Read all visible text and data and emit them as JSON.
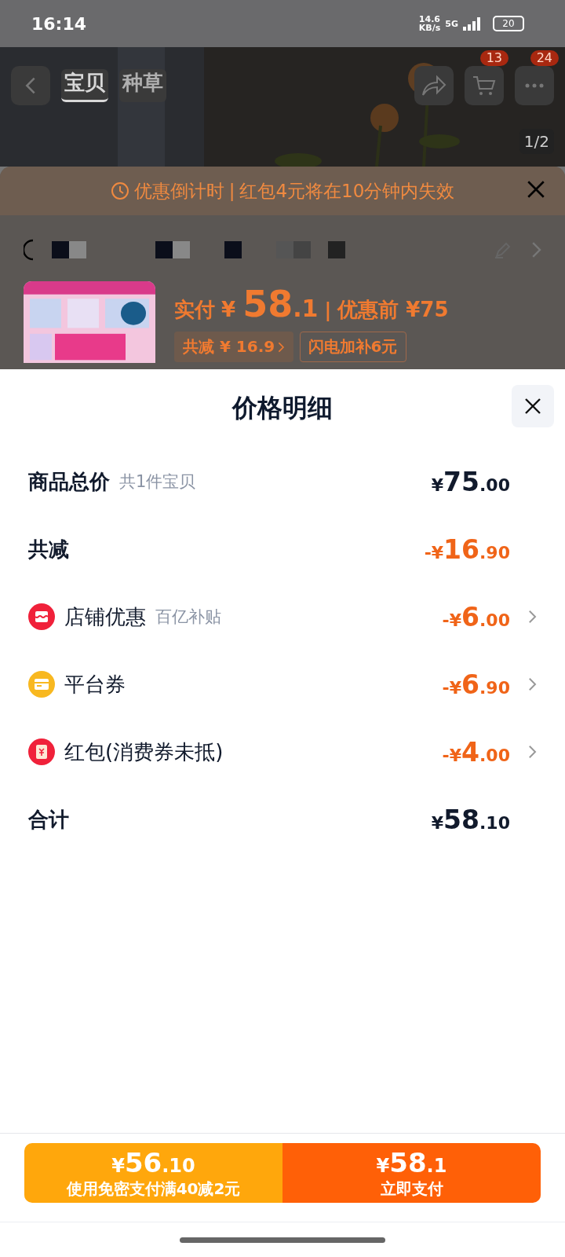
{
  "status_bar": {
    "time": "16:14",
    "net_speed": "14.6",
    "net_unit": "KB/s",
    "network": "5G",
    "battery": "20"
  },
  "nav": {
    "tabs": [
      {
        "label": "宝贝",
        "selected": true
      },
      {
        "label": "种草",
        "selected": false
      }
    ],
    "cart_badge": "13",
    "more_badge": "24",
    "image_counter": "1/2"
  },
  "order": {
    "countdown_label": "优惠倒计时",
    "countdown_separator": "|",
    "price_separator": "|",
    "countdown_message": "红包4元将在10分钟内失效",
    "paid_label": "实付",
    "paid_symbol": "¥",
    "paid_main": "58",
    "paid_fraction": ".1",
    "before_label": "优惠前 ¥75",
    "chips": [
      {
        "text": "共减 ¥ 16.9",
        "arrow": true,
        "filled": true
      },
      {
        "text": "闪电加补6元",
        "arrow": false,
        "filled": false
      }
    ]
  },
  "sheet": {
    "title": "价格明细",
    "rows": [
      {
        "kind": "summary",
        "label": "商品总价",
        "note": "共1件宝贝",
        "sign": "",
        "symbol": "¥",
        "main": "75",
        "fraction": ".00",
        "arrow": false
      },
      {
        "kind": "summary",
        "label": "共减",
        "sign": "-",
        "symbol": "¥",
        "main": "16",
        "fraction": ".90",
        "arrow": false
      },
      {
        "kind": "shop",
        "label": "店铺优惠",
        "note": "百亿补贴",
        "sign": "-",
        "symbol": "¥",
        "main": "6",
        "fraction": ".00",
        "arrow": true
      },
      {
        "kind": "coupon",
        "label": "平台券",
        "sign": "-",
        "symbol": "¥",
        "main": "6",
        "fraction": ".90",
        "arrow": true
      },
      {
        "kind": "packet",
        "label": "红包(消费券未抵)",
        "sign": "-",
        "symbol": "¥",
        "main": "4",
        "fraction": ".00",
        "arrow": true
      },
      {
        "kind": "summary",
        "label": "合计",
        "sign": "",
        "symbol": "¥",
        "main": "58",
        "fraction": ".10",
        "arrow": false
      }
    ]
  },
  "footer": {
    "buttons": [
      {
        "kind": "secondary",
        "symbol": "¥",
        "main": "56",
        "fraction": ".10",
        "caption": "使用免密支付满40减2元"
      },
      {
        "kind": "primary",
        "symbol": "¥",
        "main": "58",
        "fraction": ".1",
        "caption": "立即支付"
      }
    ]
  }
}
